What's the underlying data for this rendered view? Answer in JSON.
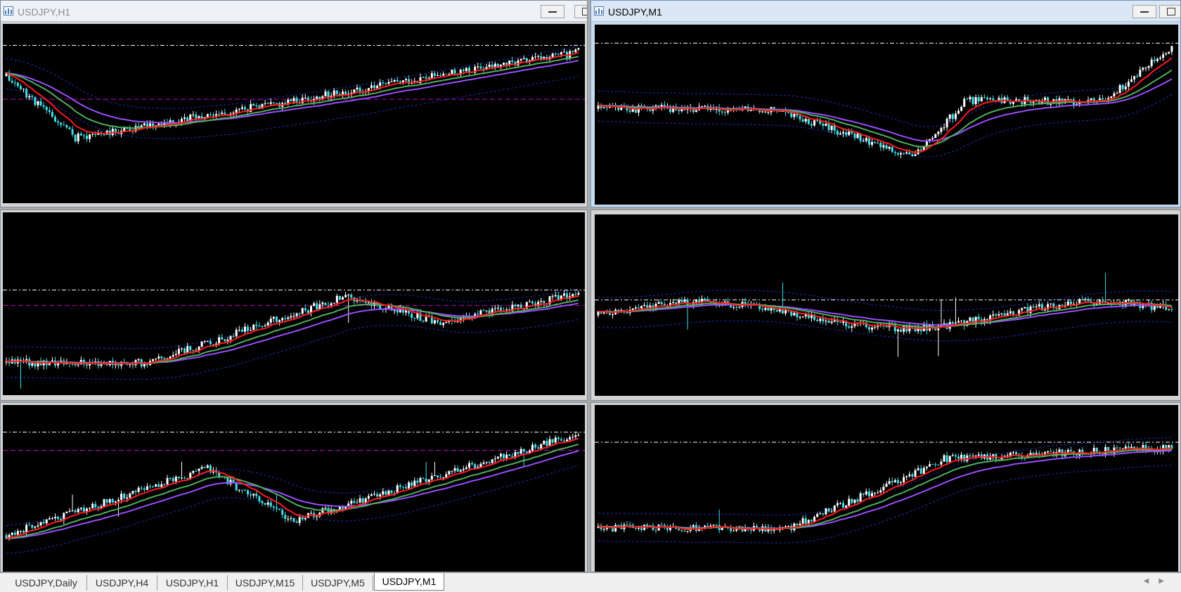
{
  "windows": [
    {
      "title": "USDJPY,H1",
      "active": false,
      "seed": 11,
      "trend": "down-up",
      "spike": 0.0
    },
    {
      "title": "USDJPY,M1",
      "active": true,
      "seed": 23,
      "trend": "flat-dip-up",
      "spike": 0.0
    },
    {
      "title": "",
      "active": false,
      "seed": 37,
      "trend": "up-spike",
      "spike": 1.0
    },
    {
      "title": "",
      "active": false,
      "seed": 41,
      "trend": "range-spike",
      "spike": 1.0
    },
    {
      "title": "",
      "active": false,
      "seed": 53,
      "trend": "up-dip-up",
      "spike": 0.6
    },
    {
      "title": "",
      "active": false,
      "seed": 67,
      "trend": "flat-up",
      "spike": 0.6
    }
  ],
  "tabs": [
    {
      "label": "USDJPY,Daily",
      "active": false
    },
    {
      "label": "USDJPY,H4",
      "active": false
    },
    {
      "label": "USDJPY,H1",
      "active": false
    },
    {
      "label": "USDJPY,M15",
      "active": false
    },
    {
      "label": "USDJPY,M5",
      "active": false
    },
    {
      "label": "USDJPY,M1",
      "active": true
    }
  ],
  "icons": {
    "window_icon": "chart-window-icon",
    "minimize": "minimize-icon",
    "restore": "restore-icon",
    "tab_scroll_left": "arrow-left-icon",
    "tab_scroll_right": "arrow-right-icon"
  },
  "colors": {
    "background": "#000000",
    "bull_candle": "#ffffff",
    "bear_candle": "#40e0e8",
    "ma_fast": "#ff1a1a",
    "ma_mid": "#4fae5f",
    "ma_slow": "#9b4dff",
    "bands": "#1d2fb8",
    "ask_line": "#ffffff",
    "level_line": "#c000c0"
  }
}
